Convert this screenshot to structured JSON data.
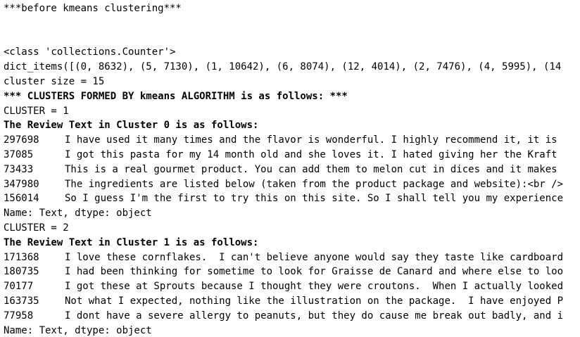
{
  "output": {
    "header": "***before kmeans clustering***",
    "class_line": "<class 'collections.Counter'>",
    "dict_items_line": "dict_items([(0, 8632), (5, 7130), (1, 10642), (6, 8074), (12, 4014), (2, 7476), (4, 5995), (14",
    "cluster_size_line": "cluster size = 15",
    "clusters_formed_line": "*** CLUSTERS FORMED BY kmeans ALGORITHM is as follows: ***",
    "clusters": [
      {
        "cluster_label": "CLUSTER = 1",
        "review_header": "The Review Text in Cluster 0 is as follows:",
        "rows": [
          {
            "id": "297698",
            "text": "I have used it many times and the flavor is wonderful. I highly recommend it, it is"
          },
          {
            "id": "37085",
            "text": "I got this pasta for my 14 month old and she loves it. I hated giving her the Kraft"
          },
          {
            "id": "73433",
            "text": "This is a real gourmet product. You can add them to melon cut in dices and it makes"
          },
          {
            "id": "347980",
            "text": "The ingredients are listed below (taken from the product package and website):<br />"
          },
          {
            "id": "156014",
            "text": "So I guess I'm the first to try this on this site. So I shall tell you my experience"
          }
        ],
        "footer": "Name: Text, dtype: object"
      },
      {
        "cluster_label": "CLUSTER = 2",
        "review_header": "The Review Text in Cluster 1 is as follows:",
        "rows": [
          {
            "id": "171368",
            "text": "I love these cornflakes.  I can't believe anyone would say they taste like cardboard"
          },
          {
            "id": "180735",
            "text": "I had been thinking for sometime to look for Graisse de Canard and where else to loo"
          },
          {
            "id": "70177",
            "text": "I got these at Sprouts because I thought they were croutons.  When I actually looked"
          },
          {
            "id": "163735",
            "text": "Not what I expected, nothing like the illustration on the package.  I have enjoyed P"
          },
          {
            "id": "77958",
            "text": "I dont have a severe allergy to peanuts, but they do cause me break out badly, and i"
          }
        ],
        "footer": "Name: Text, dtype: object"
      }
    ]
  }
}
